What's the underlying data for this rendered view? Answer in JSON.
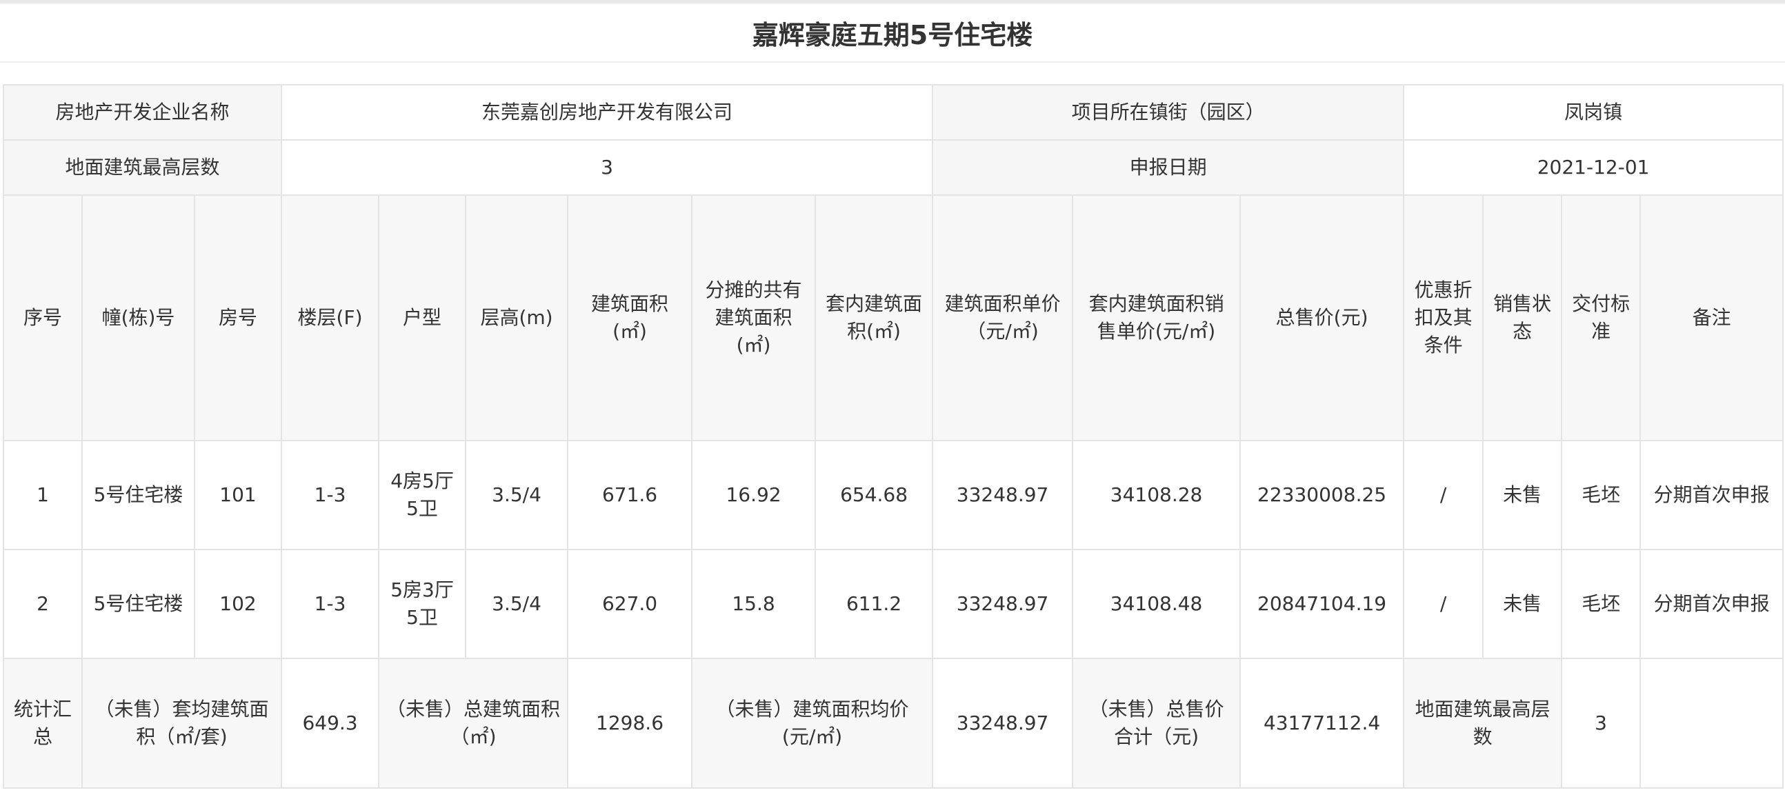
{
  "page": {
    "title": "嘉辉豪庭五期5号住宅楼"
  },
  "info": {
    "developer_label": "房地产开发企业名称",
    "developer_value": "东莞嘉创房地产开发有限公司",
    "town_label": "项目所在镇街（园区）",
    "town_value": "凤岗镇",
    "max_floors_label": "地面建筑最高层数",
    "max_floors_value": "3",
    "report_date_label": "申报日期",
    "report_date_value": "2021-12-01"
  },
  "headers": {
    "seq": "序号",
    "building": "幢(栋)号",
    "room": "房号",
    "floor": "楼层(F)",
    "unit_type": "户型",
    "floor_height": "层高(m)",
    "gross_area": "建筑面积(㎡)",
    "shared_area": "分摊的共有建筑面积(㎡)",
    "inner_area": "套内建筑面积(㎡)",
    "gross_unit_price": "建筑面积单价（元/㎡)",
    "inner_unit_price": "套内建筑面积销售单价(元/㎡)",
    "total_price": "总售价(元)",
    "discount": "优惠折扣及其条件",
    "sale_status": "销售状态",
    "delivery_std": "交付标准",
    "remark": "备注"
  },
  "rows": [
    {
      "seq": "1",
      "building": "5号住宅楼",
      "room": "101",
      "floor": "1-3",
      "unit_type": "4房5厅5卫",
      "floor_height": "3.5/4",
      "gross_area": "671.6",
      "shared_area": "16.92",
      "inner_area": "654.68",
      "gross_unit_price": "33248.97",
      "inner_unit_price": "34108.28",
      "total_price": "22330008.25",
      "discount": "/",
      "sale_status": "未售",
      "delivery_std": "毛坯",
      "remark": "分期首次申报"
    },
    {
      "seq": "2",
      "building": "5号住宅楼",
      "room": "102",
      "floor": "1-3",
      "unit_type": "5房3厅5卫",
      "floor_height": "3.5/4",
      "gross_area": "627.0",
      "shared_area": "15.8",
      "inner_area": "611.2",
      "gross_unit_price": "33248.97",
      "inner_unit_price": "34108.48",
      "total_price": "20847104.19",
      "discount": "/",
      "sale_status": "未售",
      "delivery_std": "毛坯",
      "remark": "分期首次申报"
    }
  ],
  "summary": {
    "label": "统计汇总",
    "avg_area_label": "（未售）套均建筑面积（㎡/套)",
    "avg_area_value": "649.3",
    "total_area_label": "（未售）总建筑面积（㎡)",
    "total_area_value": "1298.6",
    "avg_price_label": "（未售）建筑面积均价(元/㎡)",
    "avg_price_value": "33248.97",
    "total_price_label": "（未售）总售价合计（元)",
    "total_price_value": "43177112.4",
    "max_floors_label": "地面建筑最高层数",
    "max_floors_value": "3",
    "remark_value": ""
  }
}
